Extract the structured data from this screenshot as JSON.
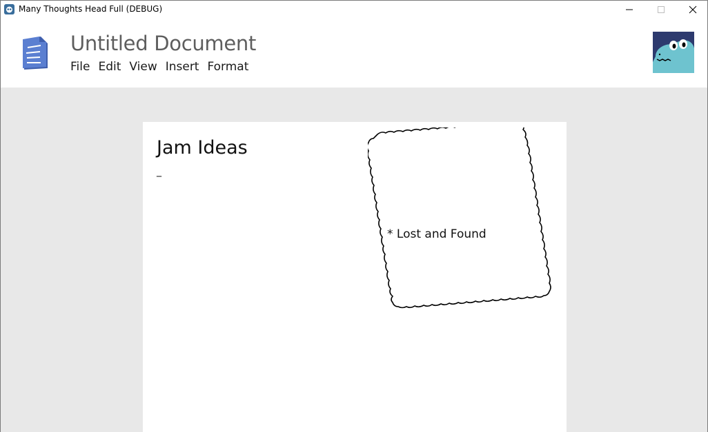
{
  "window": {
    "title": "Many Thoughts Head Full (DEBUG)",
    "controls": {
      "minimize": "minimize-icon",
      "maximize": "maximize-icon",
      "close": "close-icon"
    }
  },
  "header": {
    "doc_title": "Untitled Document",
    "menu": [
      {
        "label": "File"
      },
      {
        "label": "Edit"
      },
      {
        "label": "View"
      },
      {
        "label": "Insert"
      },
      {
        "label": "Format"
      }
    ],
    "doc_icon": "document-icon",
    "avatar": "dinosaur-avatar"
  },
  "page": {
    "heading": "Jam Ideas",
    "cursor": "_",
    "cloud_text": "* Lost and Found"
  },
  "colors": {
    "workspace_bg": "#e8e8e8",
    "doc_icon": "#5b7fd1",
    "avatar_bg": "#2d3a6e",
    "avatar_dino": "#6ec3cf",
    "title_gray": "#5e5e5e"
  }
}
